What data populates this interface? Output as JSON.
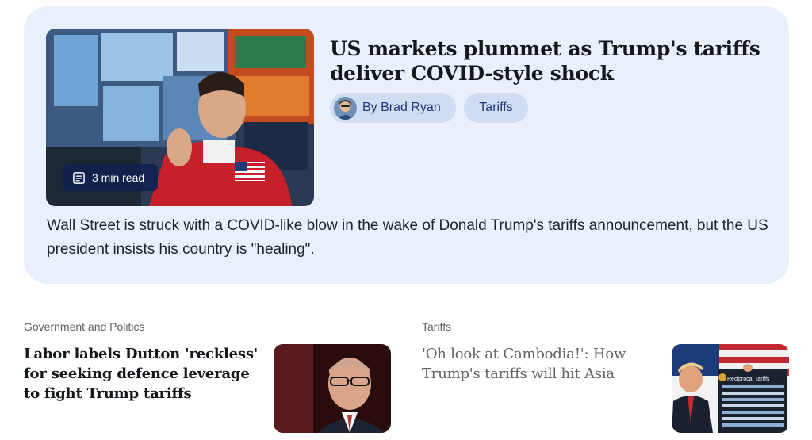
{
  "hero": {
    "title": "US markets plummet as Trump's tariffs deliver COVID-style shock",
    "read_time": "3 min read",
    "read_icon": "article-icon",
    "author_label": "By Brad Ryan",
    "topic_label": "Tariffs",
    "summary": "Wall Street is struck with a COVID-like blow in the wake of Donald Trump's tariffs announcement, but the US president insists his country is \"healing\"."
  },
  "stories": [
    {
      "category": "Government and Politics",
      "title": "Labor labels Dutton 'reckless' for seeking defence leverage to fight Trump tariffs"
    },
    {
      "category": "Tariffs",
      "title": "'Oh look at Cambodia!': How Trump's tariffs will hit Asia"
    }
  ],
  "colors": {
    "card_background": "#e9f0fb",
    "chip_background": "#cfdcf2",
    "chip_text": "#1c3a78",
    "badge_background": "#0f214e"
  }
}
